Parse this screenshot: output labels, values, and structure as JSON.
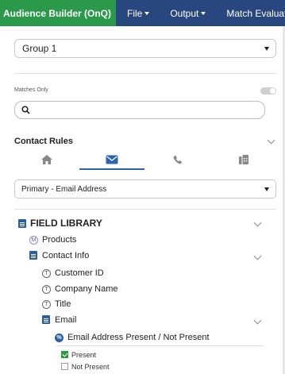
{
  "topbar": {
    "brand": "Audience Builder (OnQ)",
    "menus": [
      "File",
      "Output",
      "Match Evaluati"
    ]
  },
  "group_select": {
    "value": "Group 1"
  },
  "matches_only": {
    "label": "Matches Only",
    "enabled": false
  },
  "search": {
    "placeholder": "",
    "value": ""
  },
  "contact_rules": {
    "title": "Contact Rules",
    "tabs": [
      {
        "icon": "home-icon",
        "active": false
      },
      {
        "icon": "envelope-icon",
        "active": true
      },
      {
        "icon": "phone-icon",
        "active": false
      },
      {
        "icon": "fax-icon",
        "active": false
      }
    ]
  },
  "rule_select": {
    "value": "Primary - Email Address"
  },
  "field_library": {
    "title": "FIELD LIBRARY",
    "items": [
      {
        "label": "Products",
        "icon": "M"
      },
      {
        "label": "Contact Info",
        "icon": "folder"
      },
      {
        "label": "Customer ID",
        "icon": "T"
      },
      {
        "label": "Company Name",
        "icon": "T"
      },
      {
        "label": "Title",
        "icon": "T"
      },
      {
        "label": "Email",
        "icon": "folder"
      },
      {
        "label": "Email Address Present / Not Present",
        "icon": "%"
      }
    ],
    "options": [
      {
        "label": "Present",
        "checked": true
      },
      {
        "label": "Not Present",
        "checked": false
      }
    ]
  },
  "colors": {
    "topbar": "#28477e",
    "brand": "#2a9a4a",
    "accent": "#2b63b3"
  }
}
